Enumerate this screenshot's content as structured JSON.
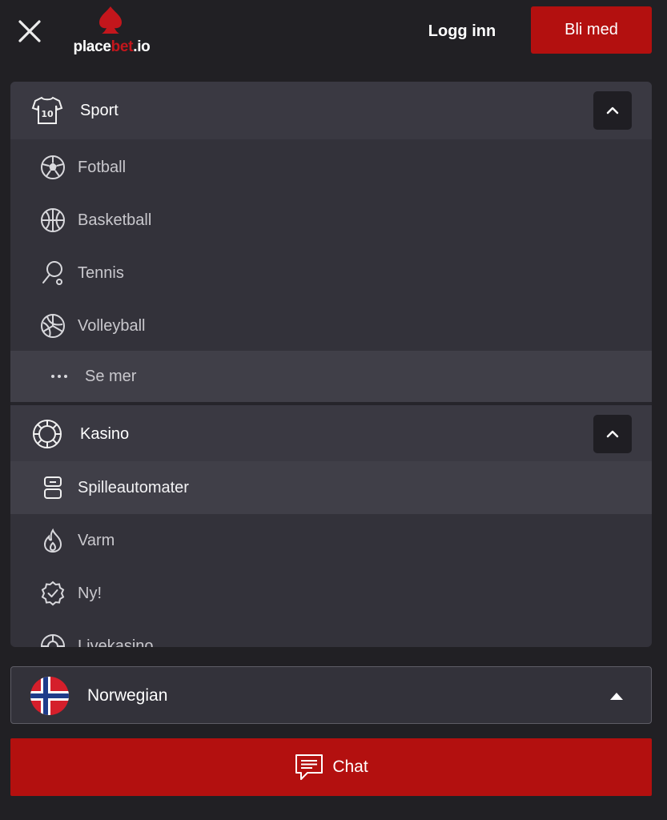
{
  "header": {
    "logo": {
      "prefix": "place",
      "accent": "bet",
      "suffix": ".io"
    },
    "login_label": "Logg inn",
    "join_label": "Bli med"
  },
  "sport_section": {
    "label": "Sport",
    "icon": "jersey-icon",
    "items": [
      {
        "label": "Fotball",
        "icon": "football-icon"
      },
      {
        "label": "Basketball",
        "icon": "basketball-icon"
      },
      {
        "label": "Tennis",
        "icon": "tennis-racket-icon"
      },
      {
        "label": "Volleyball",
        "icon": "volleyball-icon"
      },
      {
        "label": "Se mer",
        "icon": "more-dots-icon"
      }
    ]
  },
  "casino_section": {
    "label": "Kasino",
    "icon": "casino-chip-icon",
    "items": [
      {
        "label": "Spilleautomater",
        "icon": "slot-machine-icon"
      },
      {
        "label": "Varm",
        "icon": "flame-icon"
      },
      {
        "label": "Ny!",
        "icon": "new-badge-icon"
      },
      {
        "label": "Livekasino",
        "icon": "roulette-icon"
      }
    ]
  },
  "language": {
    "label": "Norwegian",
    "flag": "norway-flag-icon"
  },
  "chat": {
    "label": "Chat"
  },
  "colors": {
    "background": "#212024",
    "panel": "#33323a",
    "brand_red": "#b3100f"
  }
}
